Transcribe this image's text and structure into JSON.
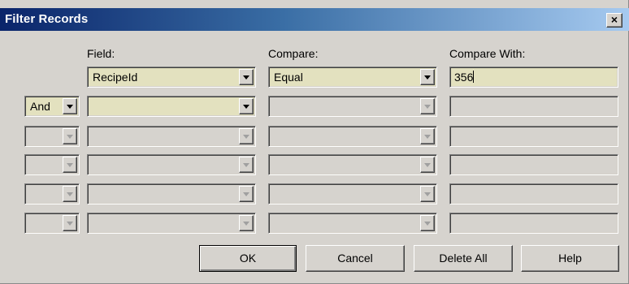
{
  "dialog": {
    "title": "Filter Records",
    "close_glyph": "×",
    "close_icon": "close-icon"
  },
  "headers": {
    "field": "Field:",
    "compare": "Compare:",
    "compare_with": "Compare With:"
  },
  "rows": [
    {
      "logic": "",
      "field": "RecipeId",
      "compare": "Equal",
      "compare_with": "356",
      "active": true
    },
    {
      "logic": "And",
      "field": "",
      "compare": "",
      "compare_with": "",
      "active": true
    },
    {
      "logic": "",
      "field": "",
      "compare": "",
      "compare_with": "",
      "active": false
    },
    {
      "logic": "",
      "field": "",
      "compare": "",
      "compare_with": "",
      "active": false
    },
    {
      "logic": "",
      "field": "",
      "compare": "",
      "compare_with": "",
      "active": false
    },
    {
      "logic": "",
      "field": "",
      "compare": "",
      "compare_with": "",
      "active": false
    }
  ],
  "buttons": {
    "ok": "OK",
    "cancel": "Cancel",
    "delete_all": "Delete All",
    "help": "Help"
  },
  "colors": {
    "title_bar_start": "#0a246a",
    "title_bar_end": "#a6caf0",
    "dialog_face": "#d6d3ce",
    "active_field": "#e3e1bf"
  }
}
